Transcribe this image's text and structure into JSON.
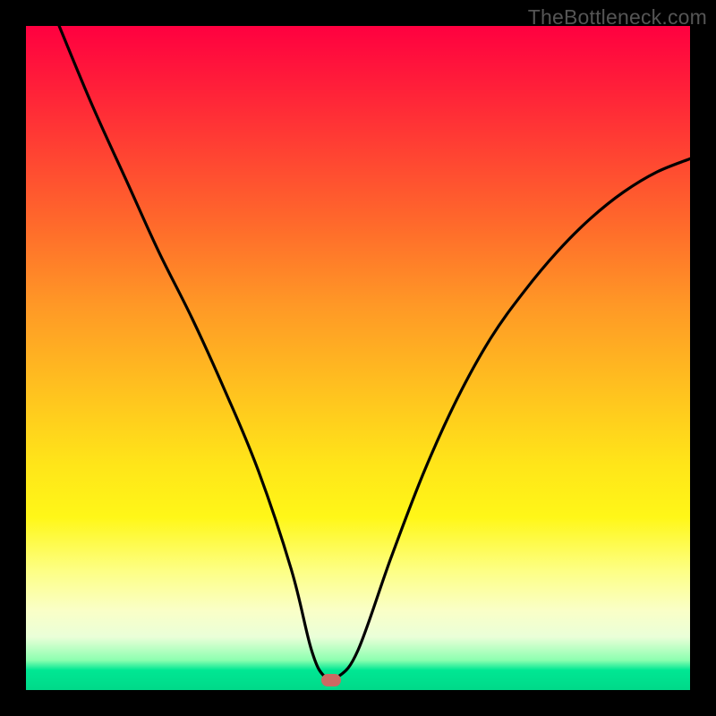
{
  "watermark": "TheBottleneck.com",
  "chart_data": {
    "type": "line",
    "title": "",
    "xlabel": "",
    "ylabel": "",
    "xlim": [
      0,
      100
    ],
    "ylim": [
      0,
      100
    ],
    "series": [
      {
        "name": "curve",
        "x": [
          5,
          10,
          15,
          20,
          25,
          30,
          35,
          40,
          43,
          45,
          47,
          50,
          55,
          60,
          65,
          70,
          75,
          80,
          85,
          90,
          95,
          100
        ],
        "y": [
          100,
          88,
          77,
          66,
          56,
          45,
          33,
          18,
          6,
          2,
          2,
          6,
          20,
          33,
          44,
          53,
          60,
          66,
          71,
          75,
          78,
          80
        ]
      }
    ],
    "marker": {
      "x": 46,
      "y": 1.5
    },
    "gradient_stops": [
      {
        "pos": 0,
        "color": "#ff0040"
      },
      {
        "pos": 50,
        "color": "#ffc21f"
      },
      {
        "pos": 80,
        "color": "#fdff84"
      },
      {
        "pos": 100,
        "color": "#00d989"
      }
    ]
  }
}
